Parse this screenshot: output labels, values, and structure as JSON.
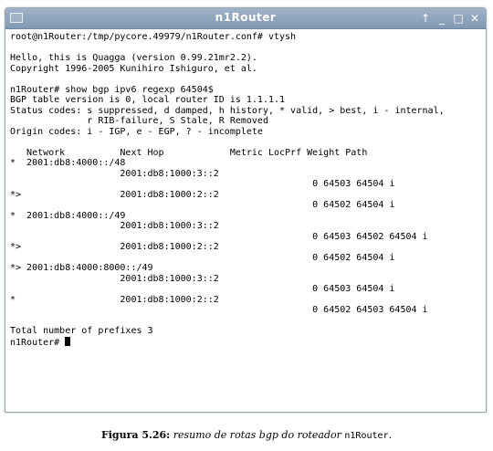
{
  "window": {
    "title": "n1Router",
    "title_buttons": [
      "↑",
      "_",
      "□",
      "✕"
    ]
  },
  "terminal": {
    "lines": [
      "root@n1Router:/tmp/pycore.49979/n1Router.conf# vtysh",
      "",
      "Hello, this is Quagga (version 0.99.21mr2.2).",
      "Copyright 1996-2005 Kunihiro Ishiguro, et al.",
      "",
      "n1Router# show bgp ipv6 regexp 64504$",
      "BGP table version is 0, local router ID is 1.1.1.1",
      "Status codes: s suppressed, d damped, h history, * valid, > best, i - internal,",
      "              r RIB-failure, S Stale, R Removed",
      "Origin codes: i - IGP, e - EGP, ? - incomplete",
      "",
      "   Network          Next Hop            Metric LocPrf Weight Path",
      "*  2001:db8:4000::/48",
      "                    2001:db8:1000:3::2",
      "                                                       0 64503 64504 i",
      "*>                  2001:db8:1000:2::2",
      "                                                       0 64502 64504 i",
      "*  2001:db8:4000::/49",
      "                    2001:db8:1000:3::2",
      "                                                       0 64503 64502 64504 i",
      "*>                  2001:db8:1000:2::2",
      "                                                       0 64502 64504 i",
      "*> 2001:db8:4000:8000::/49",
      "                    2001:db8:1000:3::2",
      "                                                       0 64503 64504 i",
      "*                   2001:db8:1000:2::2",
      "                                                       0 64502 64503 64504 i",
      "",
      "Total number of prefixes 3"
    ],
    "prompt": "n1Router# "
  },
  "caption": {
    "label": "Figura 5.26:",
    "text": " resumo de rotas bgp do roteador ",
    "code": "n1Router",
    "end": "."
  }
}
